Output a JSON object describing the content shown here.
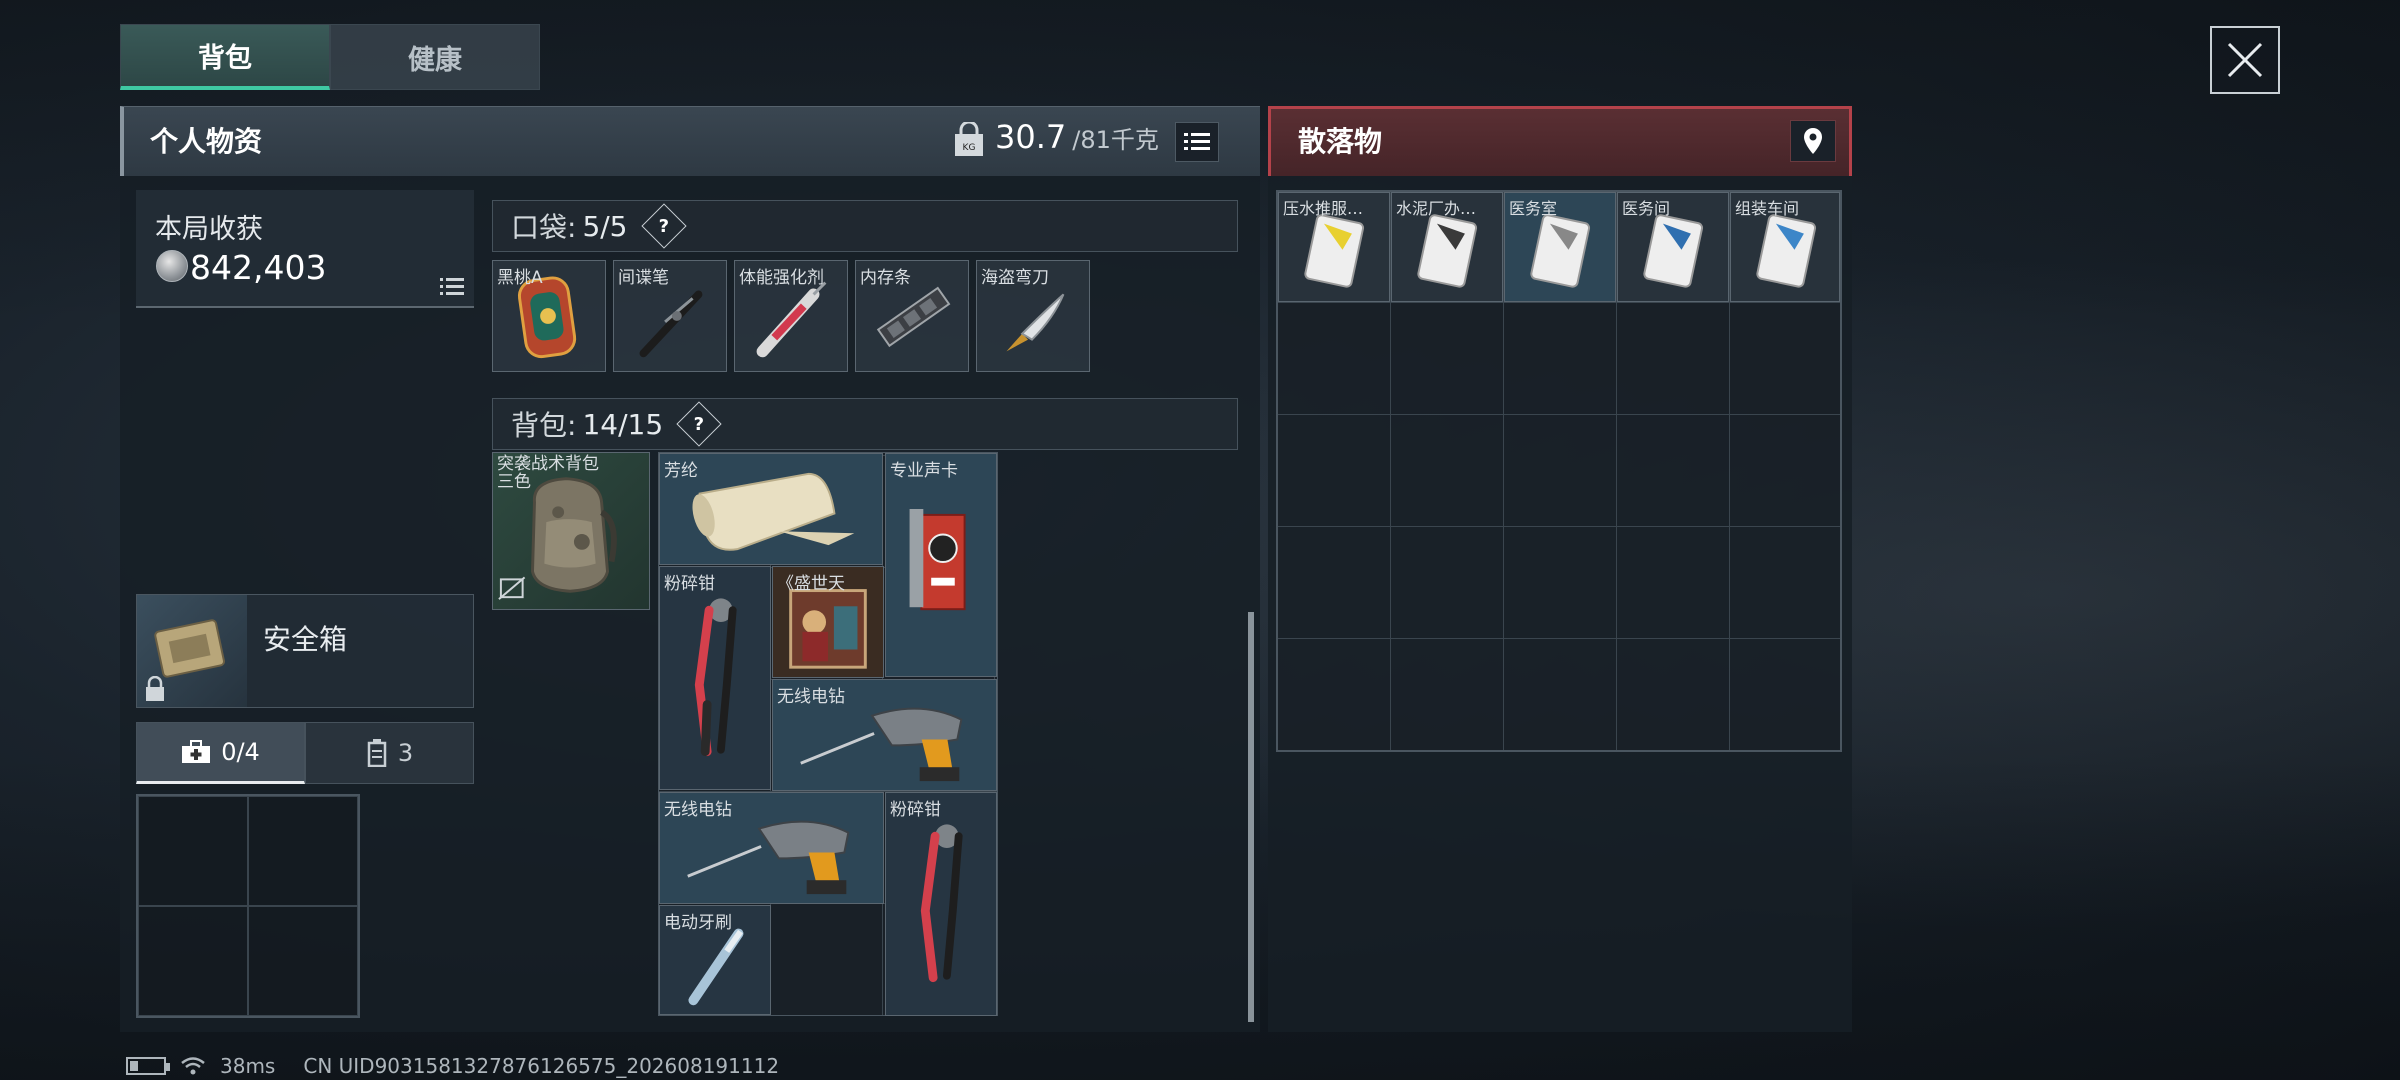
{
  "tabs": [
    {
      "label": "背包",
      "active": true
    },
    {
      "label": "健康",
      "active": false
    }
  ],
  "personal": {
    "title": "个人物资",
    "weight_current": "30.7",
    "weight_max": "/81千克"
  },
  "loot": {
    "title": "本局收获",
    "value": "842,403"
  },
  "safe_box": {
    "label": "安全箱"
  },
  "mini_tabs": [
    {
      "label": "0/4",
      "icon": "medkit-icon",
      "active": true
    },
    {
      "label": "3",
      "icon": "magazine-icon",
      "active": false
    }
  ],
  "pocket": {
    "label": "口袋:",
    "count": "5/5",
    "help": "?",
    "items": [
      {
        "name": "黑桃A",
        "icon": "card-icon"
      },
      {
        "name": "间谍笔",
        "icon": "pen-icon"
      },
      {
        "name": "体能强化剂",
        "icon": "injector-icon"
      },
      {
        "name": "内存条",
        "icon": "ram-icon"
      },
      {
        "name": "海盗弯刀",
        "icon": "knife-icon"
      }
    ]
  },
  "backpack": {
    "label": "背包:",
    "count": "14/15",
    "help": "?",
    "bag_name": "突袭战术背包",
    "bag_sub": "三色",
    "items": [
      {
        "name": "芳纶",
        "icon": "fabric-roll-icon"
      },
      {
        "name": "专业声卡",
        "icon": "sound-card-icon"
      },
      {
        "name": "粉碎钳",
        "icon": "pliers-icon"
      },
      {
        "name": "《盛世天",
        "icon": "painting-icon"
      },
      {
        "name": "无线电钻",
        "icon": "drill-icon"
      },
      {
        "name": "无线电钻",
        "icon": "drill-icon"
      },
      {
        "name": "粉碎钳",
        "icon": "pliers-icon"
      },
      {
        "name": "电动牙刷",
        "icon": "toothbrush-icon"
      }
    ]
  },
  "scatter": {
    "title": "散落物",
    "items": [
      {
        "name": "压水推服…",
        "icon": "keycard-icon"
      },
      {
        "name": "水泥厂办…",
        "icon": "keycard-icon"
      },
      {
        "name": "医务室",
        "icon": "keycard-icon"
      },
      {
        "name": "医务间",
        "icon": "keycard-icon"
      },
      {
        "name": "组装车间",
        "icon": "keycard-icon"
      }
    ]
  },
  "footer": {
    "ping": "38ms",
    "uid": "CN UID903158132787612657​5_202608191112"
  },
  "colors": {
    "accent": "#3fc9a3",
    "danger": "#b4424a"
  }
}
